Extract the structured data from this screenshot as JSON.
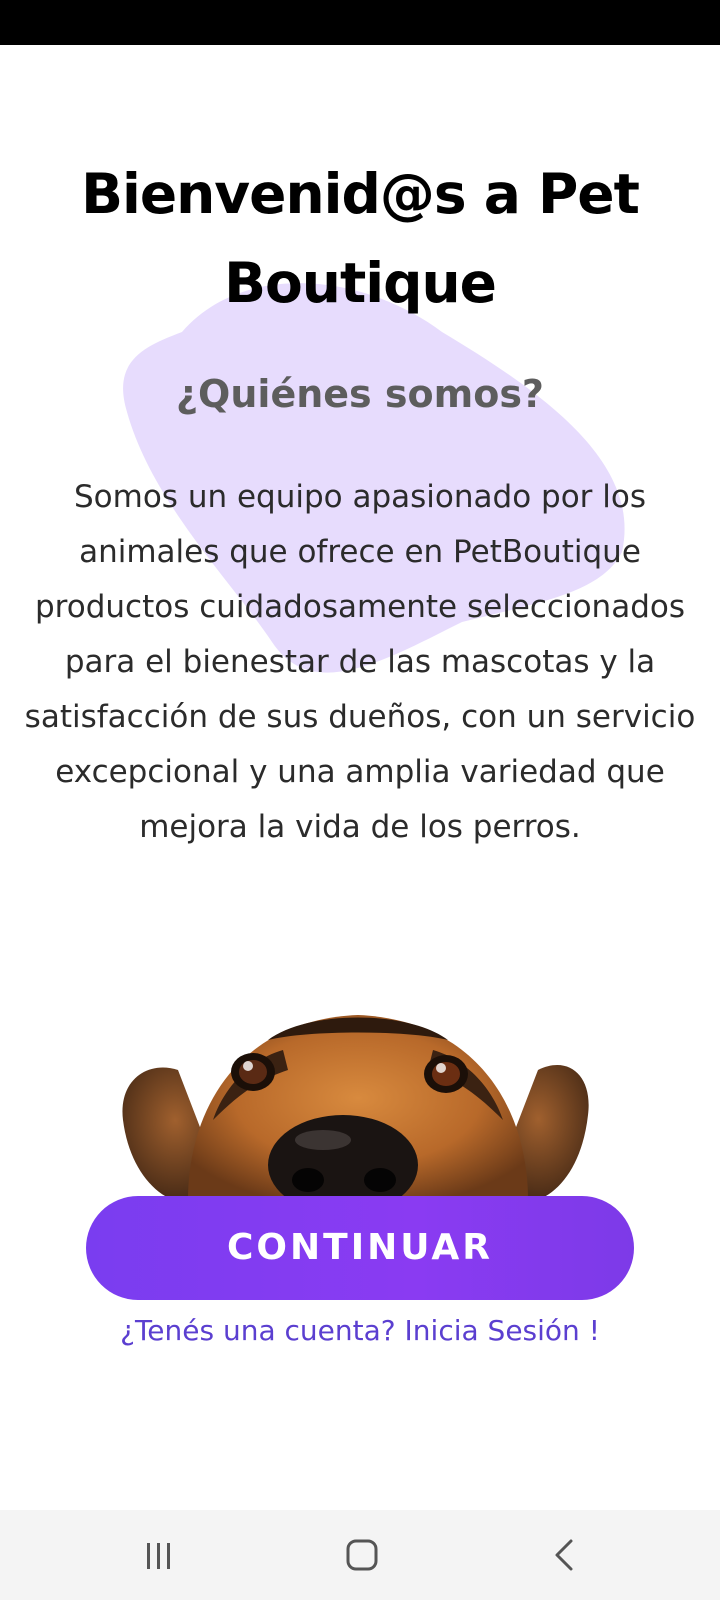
{
  "header": {
    "title": "Bienvenid@s a Pet Boutique",
    "subtitle": "¿Quiénes somos?"
  },
  "about": {
    "description": "Somos un equipo apasionado por los animales que ofrece en PetBoutique productos cuidadosamente seleccionados para el bienestar de las mascotas y la satisfacción de sus dueños, con un servicio excepcional y una amplia variedad que mejora la vida de los perros."
  },
  "actions": {
    "continue_label": "CONTINUAR",
    "login_link": "¿Tenés una cuenta? Inicia Sesión !"
  },
  "navigation": {
    "icons": [
      "recent-apps-icon",
      "home-icon",
      "back-icon"
    ]
  },
  "colors": {
    "accent": "#8a3bf2",
    "blob": "#e7dcfd",
    "link": "#5b3fd0",
    "status_bar": "#000000",
    "nav_bar": "#f4f4f4"
  }
}
